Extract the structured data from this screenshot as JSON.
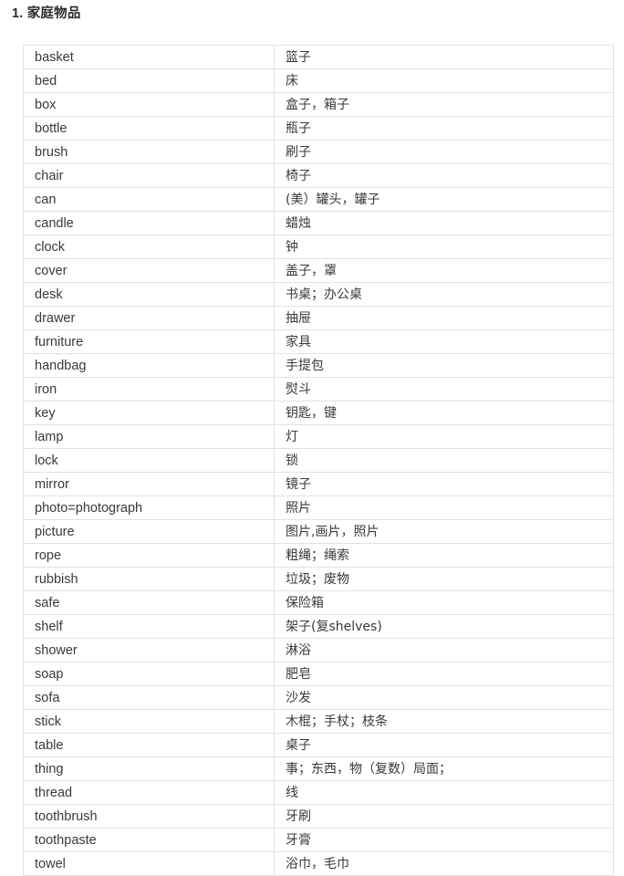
{
  "document": {
    "section_number": "1.",
    "section_title": "1. 家庭物品",
    "title_color": "#2b2b2b",
    "border_color": "#e2e2e2",
    "text_color": "#3a3a3a"
  },
  "table": {
    "name": "household-items-vocabulary",
    "columns": [
      "english",
      "chinese"
    ],
    "rows": [
      {
        "english": "basket",
        "chinese": "篮子"
      },
      {
        "english": "bed",
        "chinese": "床"
      },
      {
        "english": "box",
        "chinese": "盒子，箱子"
      },
      {
        "english": "bottle",
        "chinese": "瓶子"
      },
      {
        "english": "brush",
        "chinese": "刷子"
      },
      {
        "english": "chair",
        "chinese": "椅子"
      },
      {
        "english": "can",
        "chinese": "(美）罐头，罐子"
      },
      {
        "english": "candle",
        "chinese": "蜡烛"
      },
      {
        "english": "clock",
        "chinese": "钟"
      },
      {
        "english": "cover",
        "chinese": "盖子，罩"
      },
      {
        "english": "desk",
        "chinese": "书桌；办公桌"
      },
      {
        "english": "drawer",
        "chinese": "抽屉"
      },
      {
        "english": "furniture",
        "chinese": "家具"
      },
      {
        "english": "handbag",
        "chinese": "手提包"
      },
      {
        "english": "iron",
        "chinese": "熨斗"
      },
      {
        "english": "key",
        "chinese": "钥匙，键"
      },
      {
        "english": "lamp",
        "chinese": "灯"
      },
      {
        "english": "lock",
        "chinese": "锁"
      },
      {
        "english": "mirror",
        "chinese": "镜子"
      },
      {
        "english": "photo=photograph",
        "chinese": "照片"
      },
      {
        "english": "picture",
        "chinese": "图片,画片，照片"
      },
      {
        "english": "rope",
        "chinese": "粗绳；绳索"
      },
      {
        "english": "rubbish",
        "chinese": "垃圾；废物"
      },
      {
        "english": "safe",
        "chinese": "保险箱"
      },
      {
        "english": "shelf",
        "chinese": "架子(复shelves)"
      },
      {
        "english": "shower",
        "chinese": "淋浴"
      },
      {
        "english": "soap",
        "chinese": "肥皂"
      },
      {
        "english": "sofa",
        "chinese": "沙发"
      },
      {
        "english": "stick",
        "chinese": "木棍；手杖；枝条"
      },
      {
        "english": "table",
        "chinese": "桌子"
      },
      {
        "english": "thing",
        "chinese": "事；东西，物（复数）局面；"
      },
      {
        "english": "thread",
        "chinese": "线"
      },
      {
        "english": "toothbrush",
        "chinese": "牙刷"
      },
      {
        "english": "toothpaste",
        "chinese": "牙膏"
      },
      {
        "english": "towel",
        "chinese": "浴巾，毛巾"
      }
    ]
  }
}
